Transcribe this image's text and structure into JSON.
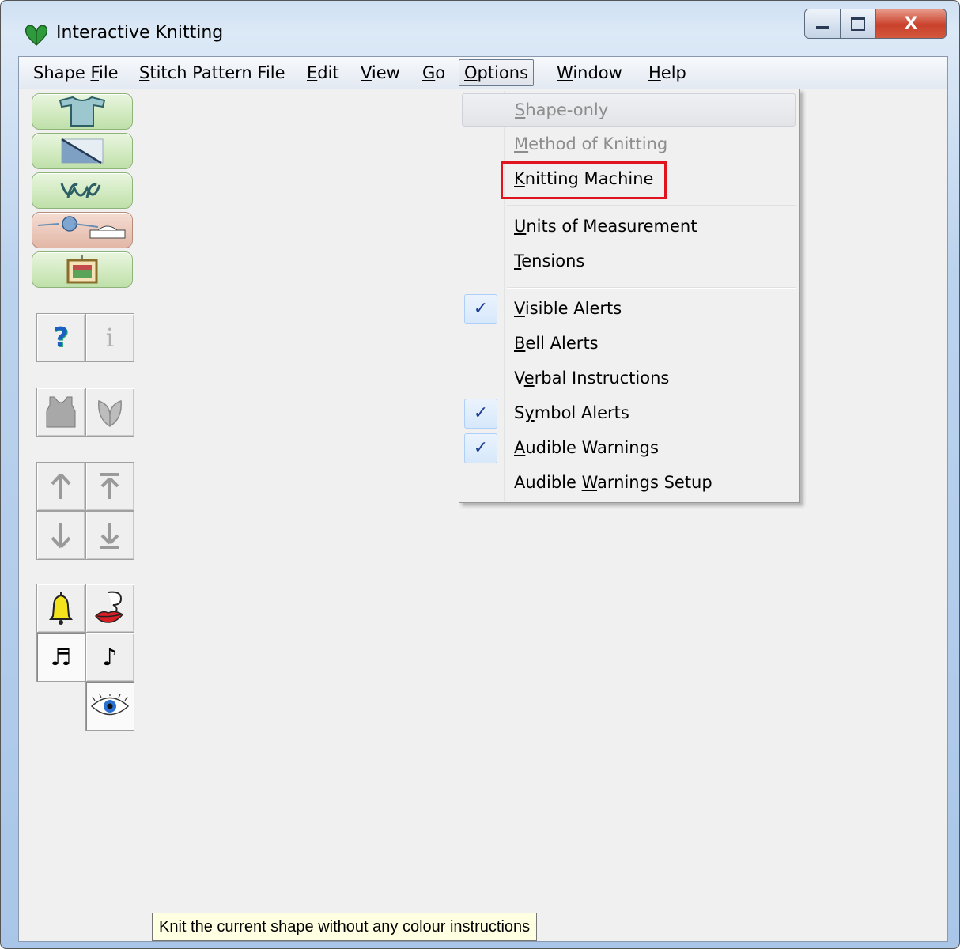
{
  "window": {
    "title": "Interactive Knitting",
    "controls": {
      "minimize": "minimize",
      "maximize": "maximize",
      "close": "X"
    }
  },
  "menubar": {
    "items": [
      {
        "label": "Shape File",
        "mnemonic": "F"
      },
      {
        "label": "Stitch Pattern File",
        "mnemonic": "S"
      },
      {
        "label": "Edit",
        "mnemonic": "E"
      },
      {
        "label": "View",
        "mnemonic": "V"
      },
      {
        "label": "Go",
        "mnemonic": "G"
      },
      {
        "label": "Options",
        "mnemonic": "O",
        "open": true
      },
      {
        "label": "Window",
        "mnemonic": "W"
      },
      {
        "label": "Help",
        "mnemonic": "H"
      }
    ]
  },
  "options_menu": {
    "items": [
      {
        "label": "Shape-only",
        "disabled": true,
        "hover": true,
        "checked": false
      },
      {
        "label": "Method of Knitting",
        "disabled": true,
        "checked": false
      },
      {
        "label": "Knitting Machine",
        "disabled": false,
        "checked": false,
        "highlighted": true
      },
      {
        "label": "Units of Measurement",
        "disabled": false,
        "checked": false
      },
      {
        "label": "Tensions",
        "disabled": false,
        "checked": false
      },
      {
        "label": "Visible Alerts",
        "disabled": false,
        "checked": true
      },
      {
        "label": "Bell Alerts",
        "disabled": false,
        "checked": false
      },
      {
        "label": "Verbal Instructions",
        "disabled": false,
        "checked": false
      },
      {
        "label": "Symbol Alerts",
        "disabled": false,
        "checked": true
      },
      {
        "label": "Audible Warnings",
        "disabled": false,
        "checked": true
      },
      {
        "label": "Audible Warnings Setup",
        "disabled": false,
        "checked": false
      }
    ],
    "check_glyph": "✓"
  },
  "toolbar": {
    "mode_buttons": [
      {
        "icon": "sweater-icon"
      },
      {
        "icon": "shaping-grid-icon"
      },
      {
        "icon": "stitch-leaf-icon"
      },
      {
        "icon": "knitting-machine-yarn-icon",
        "active": true
      },
      {
        "icon": "framed-picture-icon"
      }
    ],
    "help_button": "?",
    "info_button": "i"
  },
  "tooltip": {
    "text": "Knit the current shape without any colour instructions"
  }
}
